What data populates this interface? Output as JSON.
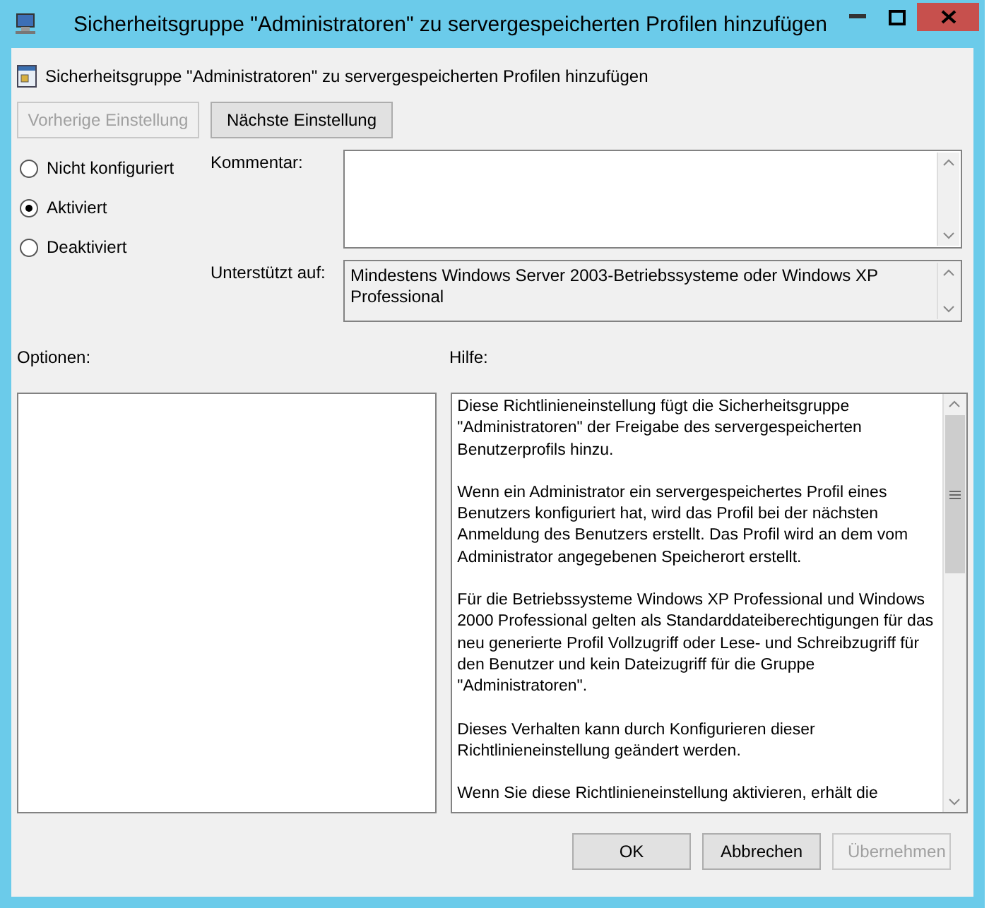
{
  "window": {
    "title": "Sicherheitsgruppe \"Administratoren\" zu servergespeicherten Profilen hinzufügen"
  },
  "header": {
    "title": "Sicherheitsgruppe \"Administratoren\" zu servergespeicherten Profilen hinzufügen"
  },
  "nav_buttons": [
    {
      "label": "Vorherige Einstellung",
      "disabled": true
    },
    {
      "label": "Nächste Einstellung",
      "disabled": false
    }
  ],
  "state_options": [
    {
      "label": "Nicht konfiguriert",
      "selected": false
    },
    {
      "label": "Aktiviert",
      "selected": true
    },
    {
      "label": "Deaktiviert",
      "selected": false
    }
  ],
  "comment": {
    "label": "Kommentar:"
  },
  "supported_on": {
    "label": "Unterstützt auf:",
    "value": "Mindestens Windows Server 2003-Betriebssysteme oder Windows XP Professional"
  },
  "options": {
    "label": "Optionen:"
  },
  "help": {
    "label": "Hilfe:",
    "paragraphs": [
      "Diese Richtlinieneinstellung fügt die Sicherheitsgruppe \"Administratoren\" der Freigabe des servergespeicherten Benutzerprofils hinzu.",
      "Wenn ein Administrator ein servergespeichertes Profil eines Benutzers konfiguriert hat, wird das Profil bei der nächsten Anmeldung des Benutzers erstellt. Das Profil wird an dem vom Administrator angegebenen Speicherort erstellt.",
      "Für die Betriebssysteme Windows XP Professional und Windows 2000 Professional gelten als Standarddateiberechtigungen für das neu generierte Profil Vollzugriff oder Lese- und Schreibzugriff für den Benutzer und kein Dateizugriff für die Gruppe \"Administratoren\".",
      "Dieses Verhalten kann durch Konfigurieren dieser Richtlinieneinstellung geändert werden.",
      "Wenn Sie diese Richtlinieneinstellung aktivieren, erhält die"
    ]
  },
  "buttons": [
    {
      "label": "OK",
      "disabled": false
    },
    {
      "label": "Abbrechen",
      "disabled": false
    },
    {
      "label": "Übernehmen",
      "disabled": true
    }
  ]
}
